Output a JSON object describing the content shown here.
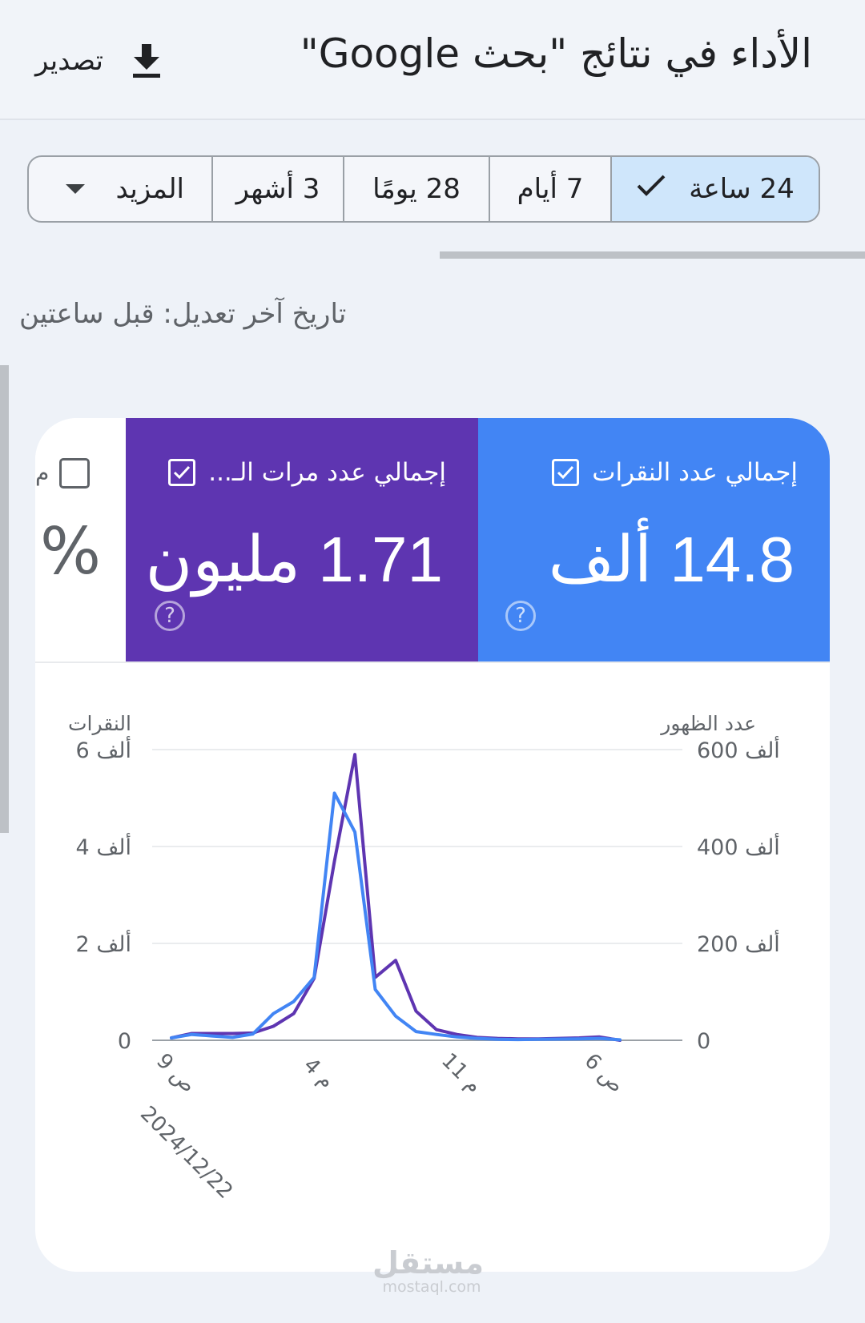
{
  "header": {
    "title": "الأداء في نتائج \"بحث Google\"",
    "export_label": "تصدير",
    "export_icon": "download-icon"
  },
  "date_range": {
    "options": [
      {
        "label": "24 ساعة",
        "selected": true,
        "icon": "check-icon"
      },
      {
        "label": "7 أيام",
        "selected": false
      },
      {
        "label": "28 يومًا",
        "selected": false
      },
      {
        "label": "3 أشهر",
        "selected": false
      },
      {
        "label": "المزيد",
        "selected": false,
        "icon": "dropdown-caret-icon"
      }
    ]
  },
  "last_updated": "تاريخ آخر تعديل: قبل ساعتين",
  "metrics": {
    "clicks": {
      "label": "إجمالي عدد النقرات",
      "value": "14.8 ألف",
      "checked": true,
      "color": "#4285f4"
    },
    "impressions": {
      "label": "إجمالي عدد مرات الـ...",
      "value": "1.71 مليون",
      "checked": true,
      "color": "#5e35b1"
    },
    "ctr": {
      "label": "م",
      "value": "%",
      "checked": false
    }
  },
  "chart_data": {
    "type": "line",
    "x": [
      "9 ص",
      "",
      "",
      "",
      "",
      "",
      "",
      "4 م",
      "",
      "",
      "",
      "",
      "",
      "",
      "11 م",
      "",
      "",
      "",
      "",
      "",
      "",
      "6 ص",
      ""
    ],
    "x_tick_labels": [
      "9 ص",
      "4 م",
      "11 م",
      "6 ص"
    ],
    "x_date_label": "2024/12/22",
    "left_axis": {
      "label": "النقرات",
      "ticks": [
        "0",
        "2 ألف",
        "4 ألف",
        "6 ألف"
      ],
      "ylim": [
        0,
        6000
      ]
    },
    "right_axis": {
      "label": "عدد الظهور",
      "ticks": [
        "0",
        "200 ألف",
        "400 ألف",
        "600 ألف"
      ],
      "ylim": [
        0,
        600000
      ]
    },
    "grid": true,
    "series": [
      {
        "axis": "left",
        "color": "#4285f4",
        "values": [
          50,
          120,
          90,
          60,
          130,
          550,
          800,
          1300,
          5100,
          4300,
          1050,
          500,
          180,
          120,
          70,
          40,
          20,
          15,
          20,
          25,
          30,
          40,
          10
        ]
      },
      {
        "axis": "right",
        "color": "#5e35b1",
        "values": [
          5000,
          14000,
          14000,
          14000,
          15000,
          29000,
          55000,
          128000,
          370000,
          590000,
          130000,
          165000,
          60000,
          22000,
          12000,
          6000,
          4000,
          3000,
          3000,
          4000,
          5000,
          7000,
          0
        ]
      }
    ]
  },
  "watermark": {
    "text": "مستقل",
    "sub": "mostaql.com"
  }
}
